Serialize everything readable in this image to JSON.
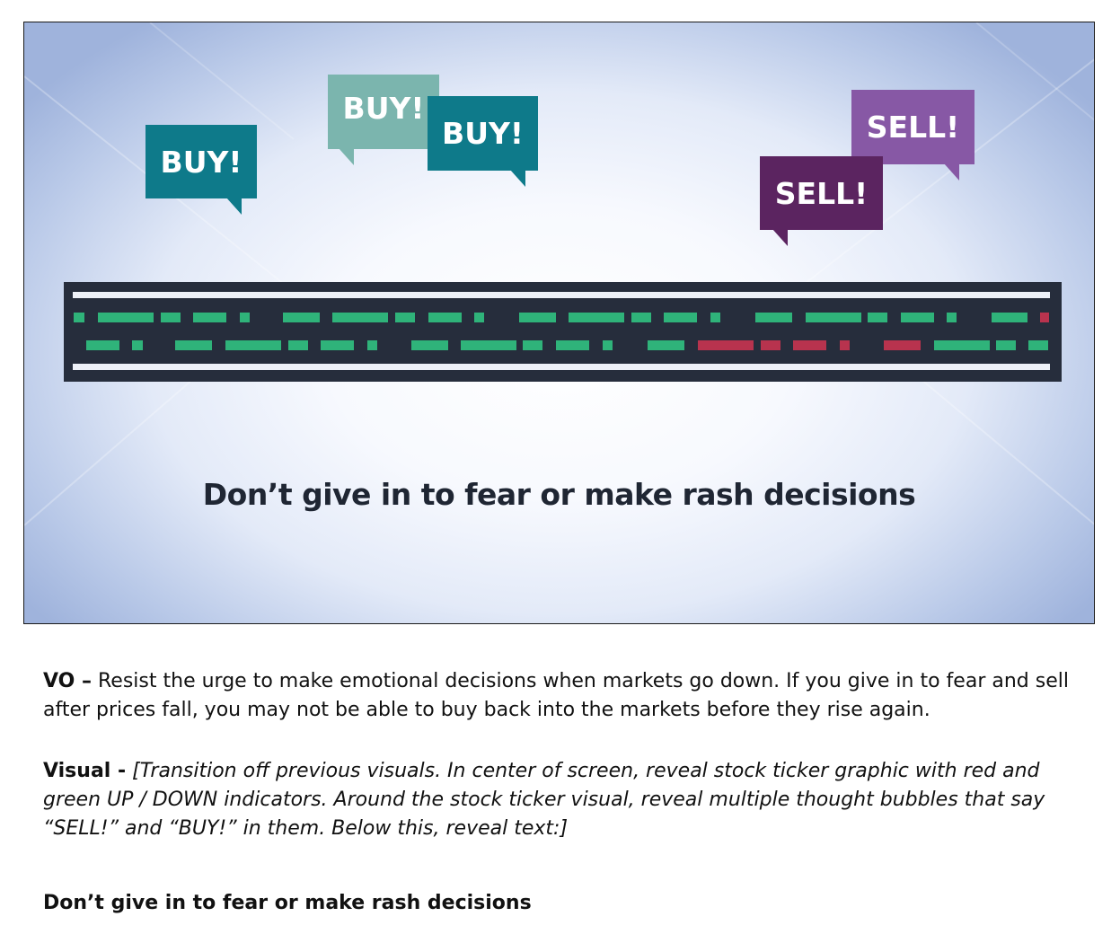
{
  "slide": {
    "bubbles": {
      "buy_1": "BUY!",
      "buy_2": "BUY!",
      "buy_3": "BUY!",
      "sell_1": "SELL!",
      "sell_2": "SELL!"
    },
    "ticker": {
      "row_1": [
        "up",
        "up",
        "up",
        "up",
        "up",
        "up",
        "up",
        "up",
        "up",
        "up",
        "up",
        "up",
        "up",
        "up",
        "up",
        "up",
        "up",
        "up",
        "up",
        "up",
        "up",
        "down",
        "down"
      ],
      "row_2": [
        "up",
        "up",
        "up",
        "up",
        "up",
        "up",
        "up",
        "up",
        "up",
        "up",
        "up",
        "up",
        "up",
        "down",
        "down",
        "down",
        "down",
        "down",
        "up",
        "up",
        "up",
        "up"
      ]
    },
    "caption": "Don’t give in to fear or make rash decisions",
    "colors": {
      "buy_teal": "#0e7a8a",
      "buy_light": "#7bb5ae",
      "sell_purple_light": "#8758a5",
      "sell_purple_dark": "#5b2460",
      "ticker_bg": "#262d3c",
      "ticker_up": "#2fb37a",
      "ticker_down": "#b8334e"
    }
  },
  "script": {
    "vo_label": "VO –",
    "vo_text": " Resist the urge to make emotional decisions when markets go down. If you give in to fear and sell after prices fall, you may not be able to buy back into the markets before they rise again.",
    "visual_label": "Visual -",
    "visual_text": " [Transition off previous visuals. In center of screen, reveal stock ticker graphic with red and green UP / DOWN indicators. Around the stock ticker visual, reveal multiple thought bubbles that say “SELL!” and “BUY!” in them. Below this, reveal text:]",
    "onscreen_text": "Don’t give in to fear or make rash decisions"
  }
}
